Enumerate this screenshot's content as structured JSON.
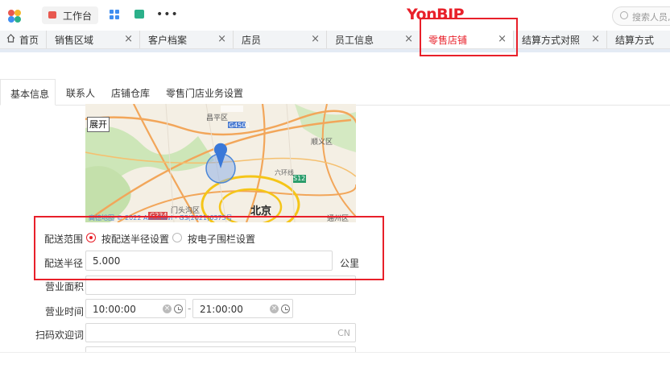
{
  "app": {
    "brand": "YonBIP",
    "workbench_label": "工作台",
    "search_placeholder": "搜索人员,",
    "more_label": "•••"
  },
  "tabs": [
    {
      "label": "首页",
      "closable": false
    },
    {
      "label": "销售区域",
      "closable": true,
      "close": "×"
    },
    {
      "label": "客户档案",
      "closable": true,
      "close": "×"
    },
    {
      "label": "店员",
      "closable": true,
      "close": "×"
    },
    {
      "label": "员工信息",
      "closable": true,
      "close": "×"
    },
    {
      "label": "零售店铺",
      "closable": true,
      "close": "×",
      "active": true
    },
    {
      "label": "结算方式对照",
      "closable": true,
      "close": "×"
    },
    {
      "label": "结算方式",
      "closable": false
    }
  ],
  "subtabs": [
    {
      "label": "基本信息",
      "active": true
    },
    {
      "label": "联系人"
    },
    {
      "label": "店铺仓库"
    },
    {
      "label": "零售门店业务设置"
    }
  ],
  "map": {
    "expand_label": "展开",
    "labels": {
      "changping": "昌平区",
      "g4501": "G4501",
      "shunyi": "顺义区",
      "s12": "S12",
      "mentougou": "门头沟区",
      "beijing": "北京",
      "g234": "G234",
      "tongzhou": "通州区",
      "ring": "六环线",
      "copyright": "高德地图 © 2022 AutoNavi - GS(2021)6375号"
    }
  },
  "form": {
    "delivery_scope_label": "配送范围",
    "radio_radius": "按配送半径设置",
    "radio_fence": "按电子围栏设置",
    "radius_label": "配送半径",
    "radius_value": "5.000",
    "radius_unit": "公里",
    "area_label": "营业面积",
    "area_value": "",
    "hours_label": "营业时间",
    "hours_start": "10:00:00",
    "hours_end": "21:00:00",
    "hours_sep": "-",
    "welcome_label": "扫码欢迎词",
    "welcome_lang": "CN",
    "clear_glyph": "×"
  },
  "colors": {
    "accent": "#e8202a",
    "annotation": "#e8202a",
    "map_marker": "#4a86d8"
  }
}
